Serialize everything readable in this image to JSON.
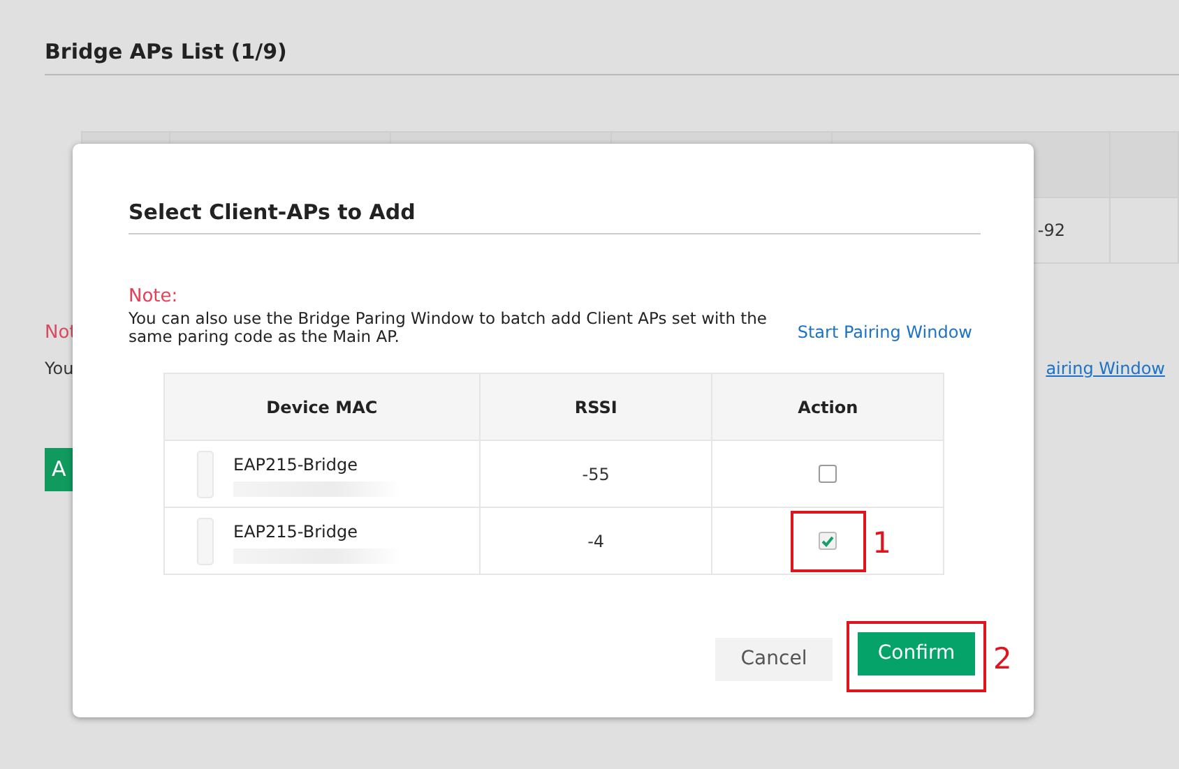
{
  "page": {
    "title": "Bridge APs List (1/9)",
    "table_cell": "-92",
    "note_label": "Not",
    "note_text": "You",
    "link": "airing Window",
    "button": "A"
  },
  "dialog": {
    "title": "Select Client-APs to Add",
    "note_label": "Note:",
    "note_text": "You can also use the Bridge Paring Window to batch add Client APs set with the same paring code as the Main AP.",
    "link": "Start Pairing Window",
    "table": {
      "columns": [
        "Device MAC",
        "RSSI",
        "Action"
      ],
      "rows": [
        {
          "name": "EAP215-Bridge",
          "rssi": "-55",
          "checked": false
        },
        {
          "name": "EAP215-Bridge",
          "rssi": "-4",
          "checked": true
        }
      ]
    },
    "buttons": [
      {
        "label": "Cancel",
        "kind": "secondary"
      },
      {
        "label": "Confirm",
        "kind": "primary"
      }
    ]
  },
  "annotations": [
    "1",
    "2"
  ]
}
